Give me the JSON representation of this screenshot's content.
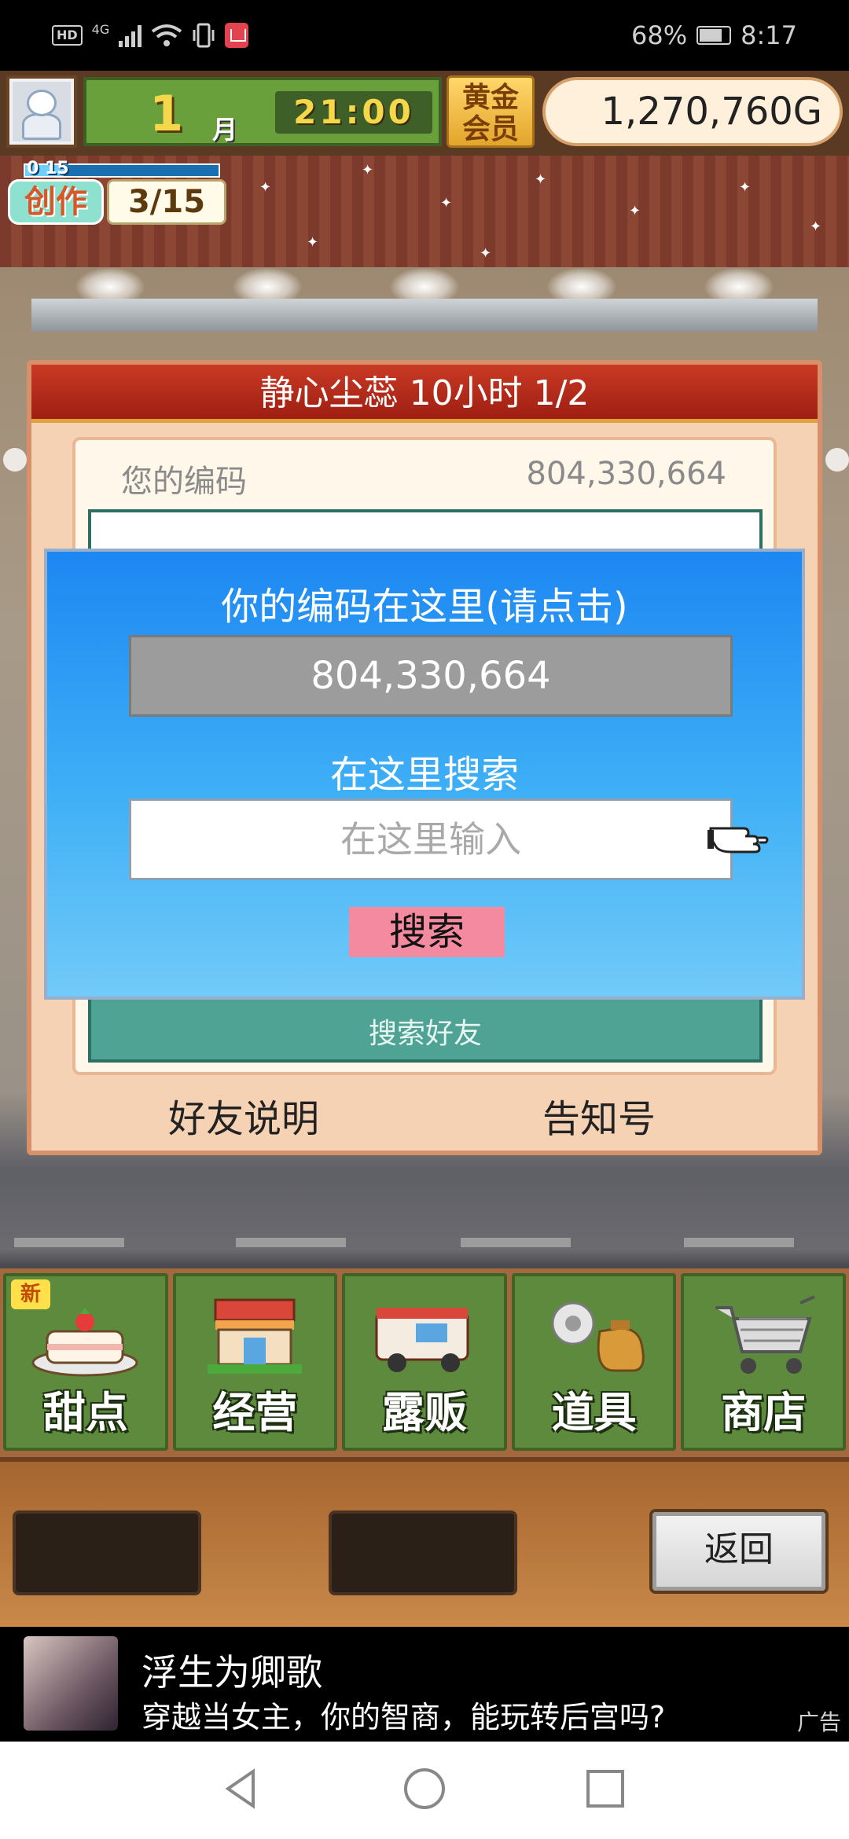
{
  "status_bar": {
    "left_hd": "HD",
    "left_net": "4G",
    "battery": "68%",
    "time": "8:17",
    "icons": [
      "signal-icon",
      "wifi-icon",
      "vibrate-icon",
      "reader-app-icon",
      "battery-icon"
    ]
  },
  "hud": {
    "month": "1",
    "month_unit": "月",
    "time": "21:00",
    "gold_member": "黄金会员",
    "money": "1,270,760G"
  },
  "create": {
    "small_label": "0 15",
    "tag": "创作",
    "count": "3/15",
    "progress": 0.2
  },
  "panel": {
    "title": "静心尘蕊  10小时 1/2",
    "code_label": "您的编码",
    "code_value": "804,330,664",
    "search_friends": "搜索好友",
    "friend_help": "好友说明",
    "notice_id": "告知号"
  },
  "dialog": {
    "title": "你的编码在这里(请点击)",
    "code": "804,330,664",
    "search_label": "在这里搜索",
    "input_placeholder": "在这里输入",
    "search_button": "搜索"
  },
  "menu": {
    "items": [
      {
        "label": "甜点",
        "icon": "cake-icon",
        "badge": "新"
      },
      {
        "label": "经营",
        "icon": "shop-icon"
      },
      {
        "label": "露贩",
        "icon": "food-truck-icon"
      },
      {
        "label": "道具",
        "icon": "items-bag-icon"
      },
      {
        "label": "商店",
        "icon": "shopping-cart-icon"
      }
    ]
  },
  "strip": {
    "back_button": "返回"
  },
  "ad": {
    "title": "浮生为卿歌",
    "desc": "穿越当女主，你的智商，能玩转后宫吗?",
    "mark": "广告"
  },
  "colors": {
    "dialog_blue": "#1d87f2",
    "search_button_pink": "#f48aa0",
    "panel_header_red": "#c93a24",
    "menu_green": "#5e8a3e"
  }
}
